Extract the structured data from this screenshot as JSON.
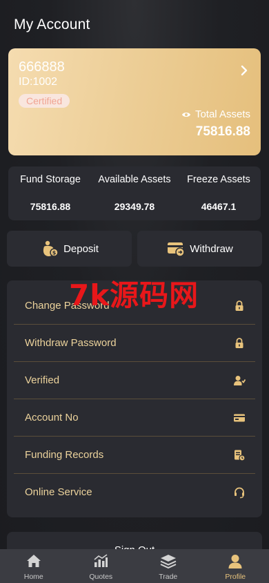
{
  "header": {
    "title": "My Account"
  },
  "account_card": {
    "username": "666888",
    "id_text": "ID:1002",
    "badge": "Certified",
    "total_assets_label": "Total Assets",
    "total_assets_value": "75816.88"
  },
  "stats": [
    {
      "label": "Fund Storage",
      "value": "75816.88"
    },
    {
      "label": "Available Assets",
      "value": "29349.78"
    },
    {
      "label": "Freeze Assets",
      "value": "46467.1"
    }
  ],
  "actions": {
    "deposit_label": "Deposit",
    "withdraw_label": "Withdraw"
  },
  "menu": [
    {
      "label": "Change Password",
      "icon": "lock-icon"
    },
    {
      "label": "Withdraw Password",
      "icon": "lock-icon"
    },
    {
      "label": "Verified",
      "icon": "user-verify-icon"
    },
    {
      "label": "Account No",
      "icon": "card-icon"
    },
    {
      "label": "Funding Records",
      "icon": "records-icon"
    },
    {
      "label": "Online Service",
      "icon": "headset-icon"
    }
  ],
  "watermark": "7k源码网",
  "sign_out_label": "Sign Out",
  "tabbar": [
    {
      "label": "Home",
      "icon": "home-icon"
    },
    {
      "label": "Quotes",
      "icon": "chart-icon"
    },
    {
      "label": "Trade",
      "icon": "layers-icon"
    },
    {
      "label": "Profile",
      "icon": "profile-icon",
      "active": true
    }
  ],
  "colors": {
    "accent": "#e8c37c",
    "menu_text": "#ecd39c",
    "panel": "#2a2b31",
    "badge_text": "#f0a493",
    "watermark": "#e8171a"
  }
}
